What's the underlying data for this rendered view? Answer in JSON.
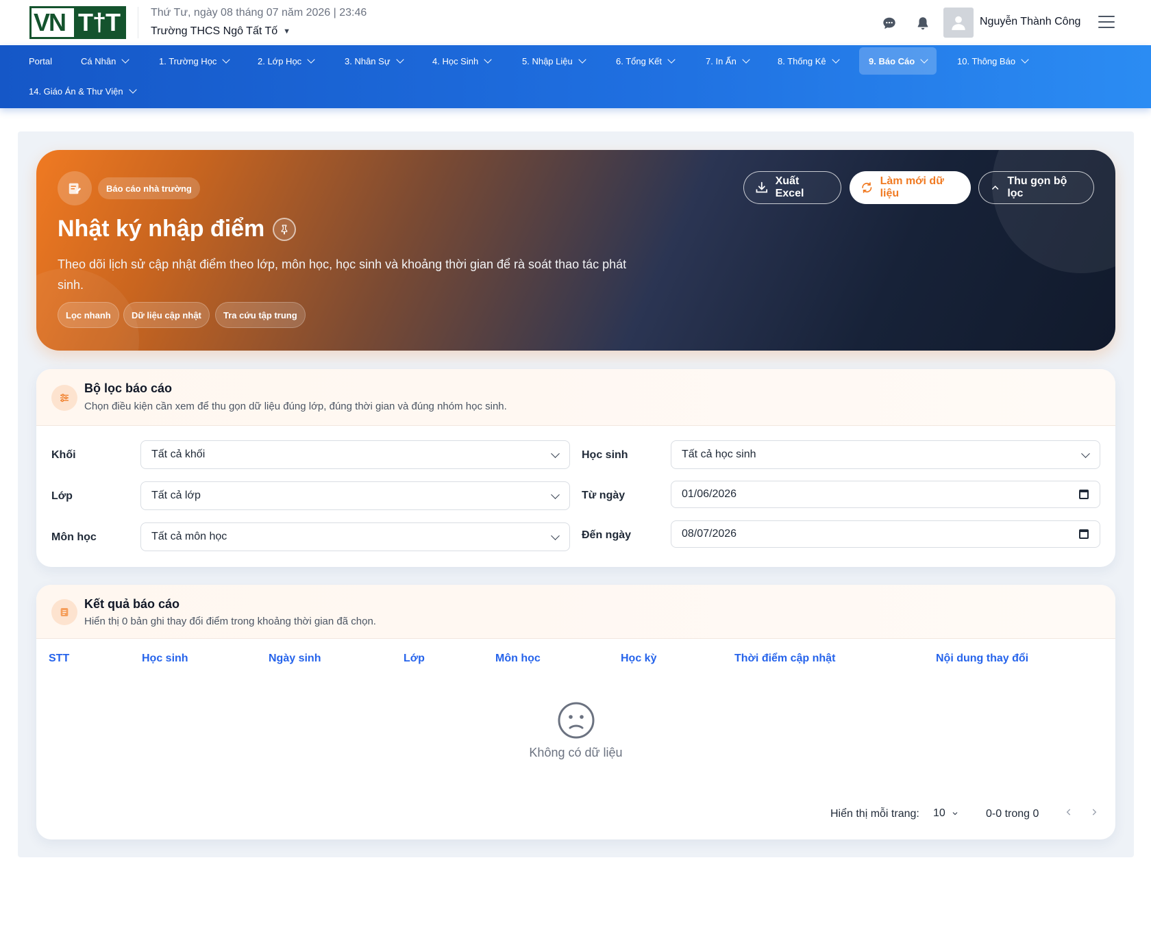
{
  "header": {
    "logo": "VNTIT",
    "date_text": "Thứ Tư, ngày 08 tháng 07 năm 2026 | 23:46",
    "school": "Trường THCS Ngô Tất Tố",
    "user_name": "Nguyễn Thành Công"
  },
  "nav": {
    "items": [
      {
        "label": "Portal"
      },
      {
        "label": "Cá Nhân"
      },
      {
        "label": "1. Trường Học"
      },
      {
        "label": "2. Lớp Học"
      },
      {
        "label": "3. Nhân Sự"
      },
      {
        "label": "4. Học Sinh"
      },
      {
        "label": "5. Nhập Liệu"
      },
      {
        "label": "6. Tổng Kết"
      },
      {
        "label": "7. In Ấn"
      },
      {
        "label": "8. Thống Kê"
      },
      {
        "label": "9. Báo Cáo"
      },
      {
        "label": "10. Thông Báo"
      },
      {
        "label": "14. Giáo Án & Thư Viện"
      }
    ],
    "active": "9. Báo Cáo"
  },
  "hero": {
    "badge": "Báo cáo nhà trường",
    "title": "Nhật ký nhập điểm",
    "description": "Theo dõi lịch sử cập nhật điểm theo lớp, môn học, học sinh và khoảng thời gian để rà soát thao tác phát sinh.",
    "chips": [
      "Lọc nhanh",
      "Dữ liệu cập nhật",
      "Tra cứu tập trung"
    ],
    "btn_export": "Xuất Excel",
    "btn_refresh": "Làm mới dữ liệu",
    "btn_collapse": "Thu gọn bộ lọc"
  },
  "filter": {
    "title": "Bộ lọc báo cáo",
    "subtitle": "Chọn điều kiện cần xem để thu gọn dữ liệu đúng lớp, đúng thời gian và đúng nhóm học sinh.",
    "grade_label": "Khối",
    "grade_value": "Tất cả khối",
    "class_label": "Lớp",
    "class_value": "Tất cả lớp",
    "subject_label": "Môn học",
    "subject_value": "Tất cả môn học",
    "student_label": "Học sinh",
    "student_value": "Tất cả học sinh",
    "from_label": "Từ ngày",
    "from_value": "01/06/2026",
    "to_label": "Đến ngày",
    "to_value": "08/07/2026"
  },
  "results": {
    "title": "Kết quả báo cáo",
    "subtitle": "Hiển thị 0 bản ghi thay đổi điểm trong khoảng thời gian đã chọn.",
    "columns": [
      "STT",
      "Học sinh",
      "Ngày sinh",
      "Lớp",
      "Môn học",
      "Học kỳ",
      "Thời điểm cập nhật",
      "Nội dung thay đổi"
    ],
    "empty_text": "Không có dữ liệu",
    "per_page_label": "Hiển thị mỗi trang:",
    "per_page_value": "10",
    "range_text": "0-0 trong 0"
  },
  "colors": {
    "accent": "#f07a22",
    "nav_blue": "#1f6fe0",
    "link_blue": "#2563eb"
  }
}
